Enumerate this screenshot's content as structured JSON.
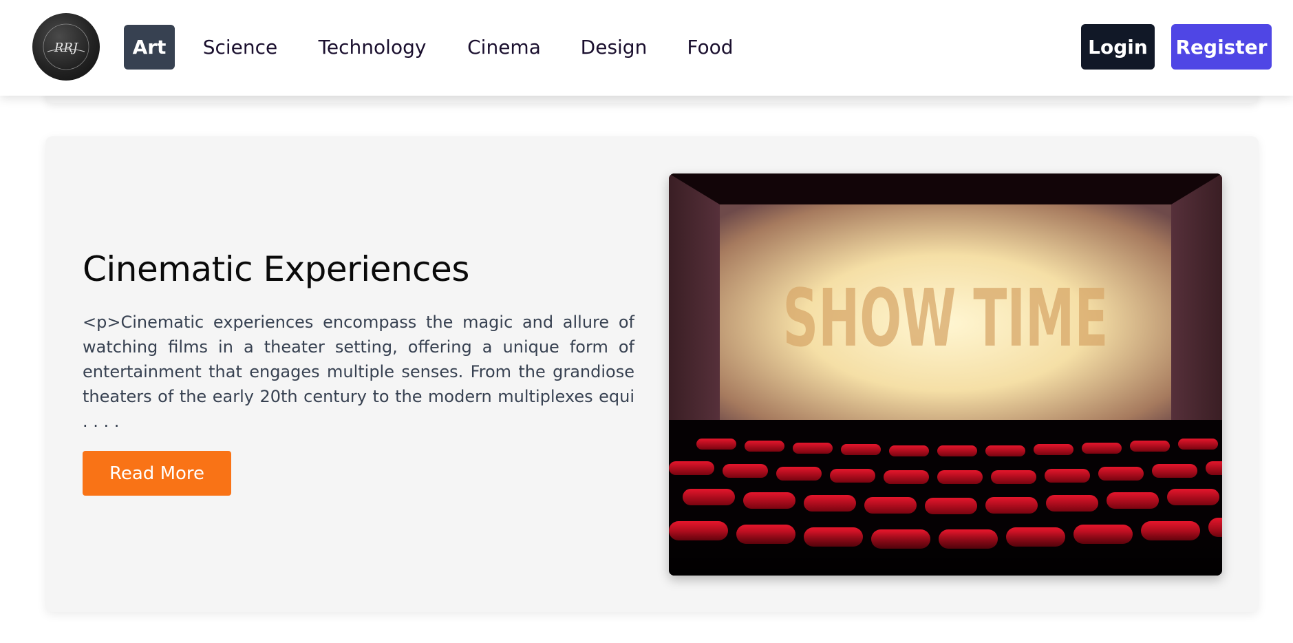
{
  "navbar": {
    "logo": {
      "text": "RRJ",
      "icon": "logo-emblem-icon"
    },
    "links": [
      {
        "label": "Art",
        "active": true
      },
      {
        "label": "Science",
        "active": false
      },
      {
        "label": "Technology",
        "active": false
      },
      {
        "label": "Cinema",
        "active": false
      },
      {
        "label": "Design",
        "active": false
      },
      {
        "label": "Food",
        "active": false
      }
    ],
    "login_label": "Login",
    "register_label": "Register"
  },
  "article": {
    "title": "Cinematic Experiences",
    "excerpt": "<p>Cinematic experiences encompass the magic and allure of watching films in a theater setting, offering a unique form of entertainment that engages multiple senses. From the grandiose theaters of the early 20th century to the modern multiplexes equi . . . .",
    "read_more_label": "Read More",
    "image": {
      "screen_text": "SHOW TIME",
      "icon": "cinema-theater-image"
    }
  },
  "colors": {
    "active_nav_bg": "#374151",
    "login_bg": "#111827",
    "register_bg": "#4f46e5",
    "read_more_bg": "#f97316",
    "card_bg": "#f5f5f5"
  }
}
